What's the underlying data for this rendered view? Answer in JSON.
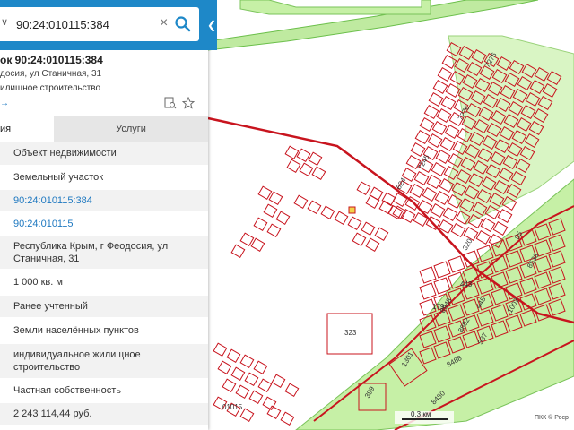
{
  "search": {
    "value": "90:24:010115:384"
  },
  "object": {
    "title": "ок 90:24:010115:384",
    "address": "досия, ул Станичная, 31",
    "use": "илищное строительство",
    "link_fragment": "→"
  },
  "tabs": [
    {
      "label": "ия"
    },
    {
      "label": "Услуги"
    }
  ],
  "rows": [
    {
      "value": "Объект недвижимости",
      "link": false
    },
    {
      "value": "Земельный участок",
      "link": false
    },
    {
      "value": "90:24:010115:384",
      "link": true
    },
    {
      "value": "90:24:010115",
      "link": true
    },
    {
      "value": "Республика Крым, г Феодосия, ул Станичная, 31",
      "link": false
    },
    {
      "value": "1 000 кв. м",
      "link": false
    },
    {
      "value": "Ранее учтенный",
      "link": false
    },
    {
      "value": "Земли населённых пунктов",
      "link": false
    },
    {
      "value": "индивидуальное жилищное строительство",
      "link": false
    },
    {
      "value": "Частная собственность",
      "link": false
    },
    {
      "value": "2 243 114,44 руб.",
      "link": false
    }
  ],
  "map": {
    "parcel_labels": [
      "7276",
      "7276",
      "7245",
      "624",
      "320",
      "85",
      "8536",
      "443",
      "179",
      "8948",
      "445",
      "1002",
      "8892",
      "537",
      "323",
      "1301",
      "8488",
      "399",
      "8480",
      "01015"
    ],
    "scale": "0,3 км",
    "attribution": "ПКК © Роср"
  },
  "colors": {
    "header": "#1e88c8",
    "link": "#1e78c0",
    "parcel": "#c8141e",
    "zone_green": "#c6f0a6"
  }
}
